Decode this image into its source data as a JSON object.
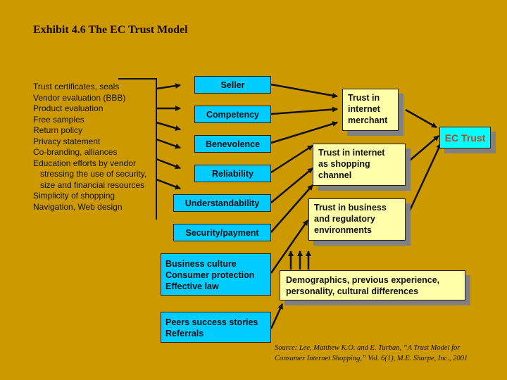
{
  "title": "Exhibit 4.6 The EC Trust Model",
  "factors": [
    {
      "text": "Trust certificates, seals",
      "indent": false
    },
    {
      "text": "Vendor evaluation (BBB)",
      "indent": false
    },
    {
      "text": "Product evaluation",
      "indent": false
    },
    {
      "text": "Free samples",
      "indent": false
    },
    {
      "text": "Return policy",
      "indent": false
    },
    {
      "text": "Privacy statement",
      "indent": false
    },
    {
      "text": "Co-branding, alliances",
      "indent": false
    },
    {
      "text": "Education efforts by vendor",
      "indent": false
    },
    {
      "text": "stressing the use of security,",
      "indent": true
    },
    {
      "text": "size and financial resources",
      "indent": true
    },
    {
      "text": "Simplicity of shopping",
      "indent": false
    },
    {
      "text": "Navigation, Web design",
      "indent": false
    }
  ],
  "attributes": {
    "seller": "Seller",
    "competency": "Competency",
    "benevolence": "Benevolence",
    "reliability": "Reliability",
    "understandability": "Understandability",
    "security": "Security/payment"
  },
  "environment": {
    "lines": [
      "Business culture",
      "Consumer protection",
      "Effective law"
    ]
  },
  "peers": {
    "lines": [
      "Peers success stories",
      "Referrals"
    ]
  },
  "trust_boxes": {
    "merchant": [
      "Trust in",
      "internet",
      "merchant"
    ],
    "channel": [
      "Trust in internet",
      "as shopping",
      "channel"
    ],
    "business": [
      "Trust in business",
      "and regulatory",
      "environments"
    ],
    "demographics": [
      "Demographics, previous experience,",
      "personality, cultural differences"
    ]
  },
  "ec_trust": "EC Trust",
  "colors": {
    "background": "#cc9900",
    "attribute_box": "#00ccff",
    "trust_box": "#ffffaa",
    "ec_trust_box": "#00ffff",
    "ec_trust_text": "#b84820",
    "shadow": "#808080"
  },
  "source": {
    "lines": [
      "Source: Lee, Matthew K.O. and E. Turban, “A Trust Model for",
      "Consumer Internet Shopping,” Vol. 6(1), M.E. Sharpe, Inc., 2001"
    ]
  }
}
